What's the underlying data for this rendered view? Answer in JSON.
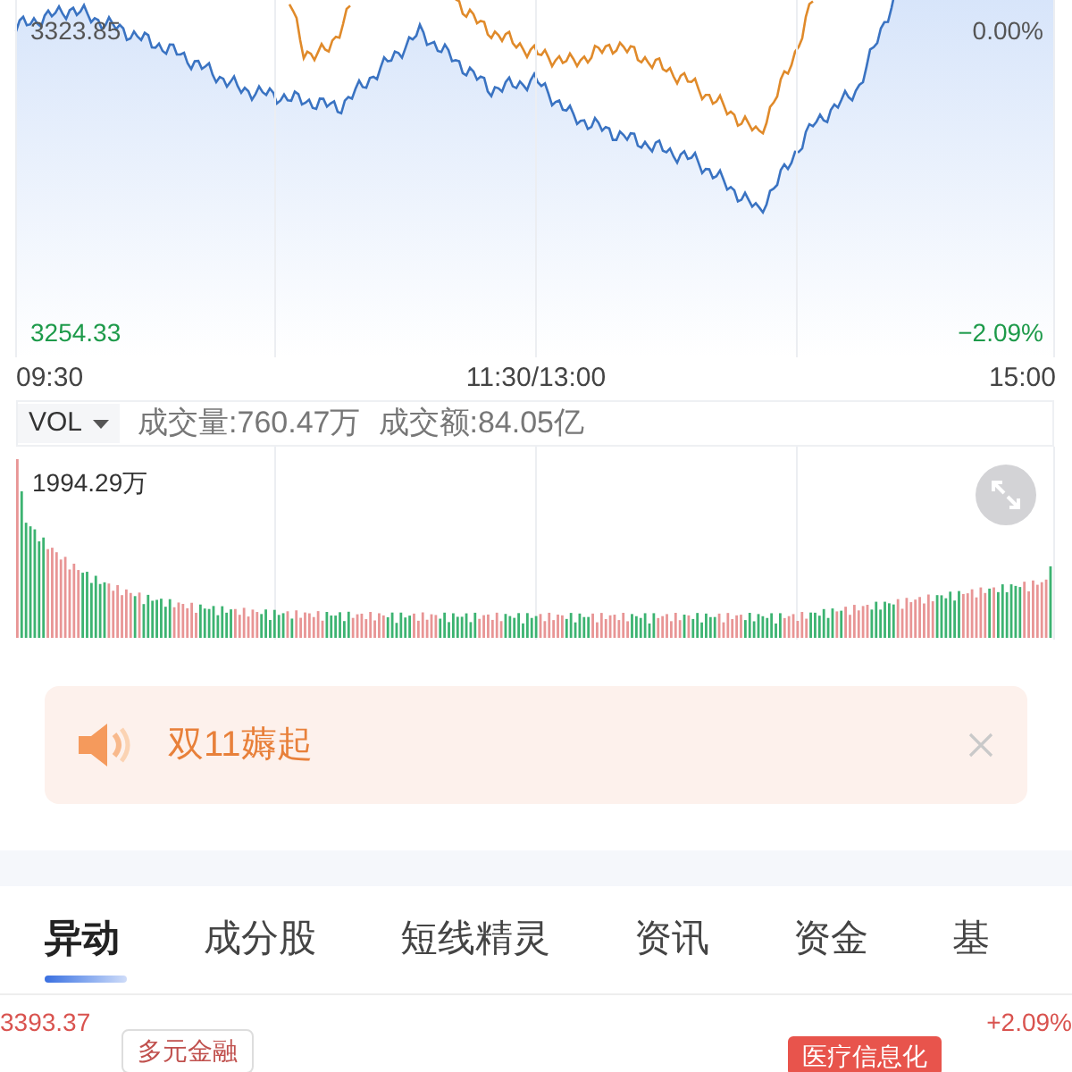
{
  "chart": {
    "top_value": "3323.85",
    "top_percent": "0.00%",
    "bottom_value": "3254.33",
    "bottom_percent": "−2.09%"
  },
  "time_axis": [
    "09:30",
    "11:30/13:00",
    "15:00"
  ],
  "volume": {
    "indicator": "VOL",
    "volume_label": "成交量:760.47万",
    "amount_label": "成交额:84.05亿",
    "max_label": "1994.29万"
  },
  "banner": {
    "text": "双11薅起"
  },
  "tabs": [
    {
      "label": "异动",
      "selected": true
    },
    {
      "label": "成分股",
      "selected": false
    },
    {
      "label": "短线精灵",
      "selected": false
    },
    {
      "label": "资讯",
      "selected": false
    },
    {
      "label": "资金",
      "selected": false
    },
    {
      "label": "基",
      "selected": false
    }
  ],
  "movers": {
    "high_value": "3393.37",
    "high_percent": "+2.09%",
    "tags": [
      {
        "label": "多元金融",
        "kind": "outline"
      },
      {
        "label": "医疗信息化",
        "kind": "filled"
      }
    ]
  }
}
